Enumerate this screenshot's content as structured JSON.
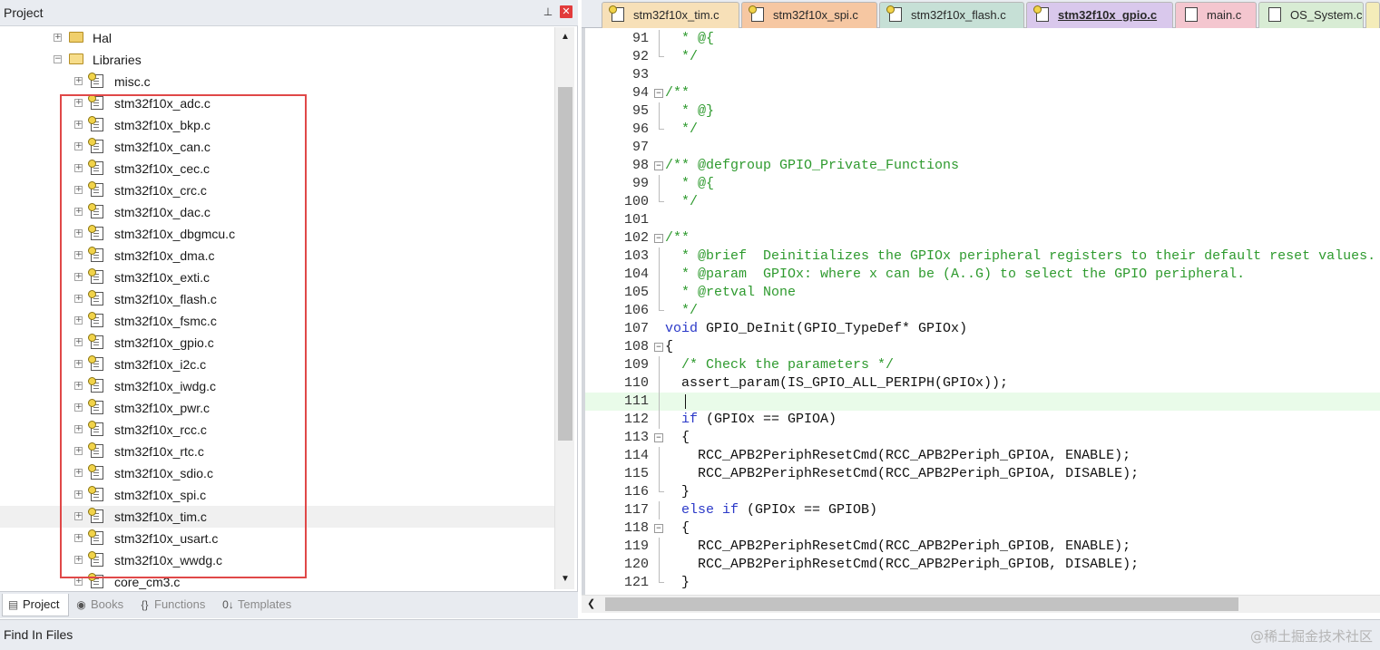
{
  "project_panel": {
    "title": "Project",
    "pin_glyph": "⊥",
    "close_glyph": "✕",
    "tree": [
      {
        "label": "Hal",
        "kind": "folder",
        "expander": "+",
        "hl": false
      },
      {
        "label": "Libraries",
        "kind": "folder-open",
        "expander": "−",
        "hl": false
      },
      {
        "label": "misc.c",
        "kind": "file",
        "expander": "+",
        "hl": false
      },
      {
        "label": "stm32f10x_adc.c",
        "kind": "file",
        "expander": "+",
        "hl": false
      },
      {
        "label": "stm32f10x_bkp.c",
        "kind": "file",
        "expander": "+",
        "hl": false
      },
      {
        "label": "stm32f10x_can.c",
        "kind": "file",
        "expander": "+",
        "hl": false
      },
      {
        "label": "stm32f10x_cec.c",
        "kind": "file",
        "expander": "+",
        "hl": false
      },
      {
        "label": "stm32f10x_crc.c",
        "kind": "file",
        "expander": "+",
        "hl": false
      },
      {
        "label": "stm32f10x_dac.c",
        "kind": "file",
        "expander": "+",
        "hl": false
      },
      {
        "label": "stm32f10x_dbgmcu.c",
        "kind": "file",
        "expander": "+",
        "hl": false
      },
      {
        "label": "stm32f10x_dma.c",
        "kind": "file",
        "expander": "+",
        "hl": false
      },
      {
        "label": "stm32f10x_exti.c",
        "kind": "file",
        "expander": "+",
        "hl": false
      },
      {
        "label": "stm32f10x_flash.c",
        "kind": "file",
        "expander": "+",
        "hl": false
      },
      {
        "label": "stm32f10x_fsmc.c",
        "kind": "file",
        "expander": "+",
        "hl": false
      },
      {
        "label": "stm32f10x_gpio.c",
        "kind": "file",
        "expander": "+",
        "hl": false
      },
      {
        "label": "stm32f10x_i2c.c",
        "kind": "file",
        "expander": "+",
        "hl": false
      },
      {
        "label": "stm32f10x_iwdg.c",
        "kind": "file",
        "expander": "+",
        "hl": false
      },
      {
        "label": "stm32f10x_pwr.c",
        "kind": "file",
        "expander": "+",
        "hl": false
      },
      {
        "label": "stm32f10x_rcc.c",
        "kind": "file",
        "expander": "+",
        "hl": false
      },
      {
        "label": "stm32f10x_rtc.c",
        "kind": "file",
        "expander": "+",
        "hl": false
      },
      {
        "label": "stm32f10x_sdio.c",
        "kind": "file",
        "expander": "+",
        "hl": false
      },
      {
        "label": "stm32f10x_spi.c",
        "kind": "file",
        "expander": "+",
        "hl": false
      },
      {
        "label": "stm32f10x_tim.c",
        "kind": "file",
        "expander": "+",
        "hl": true
      },
      {
        "label": "stm32f10x_usart.c",
        "kind": "file",
        "expander": "+",
        "hl": false
      },
      {
        "label": "stm32f10x_wwdg.c",
        "kind": "file",
        "expander": "+",
        "hl": false
      },
      {
        "label": "core_cm3.c",
        "kind": "file",
        "expander": "+",
        "hl": false
      }
    ],
    "highlight_color": "#e04848",
    "scroll_up": "▲",
    "scroll_down": "▼"
  },
  "bottom_tabs": [
    {
      "label": "Project",
      "icon": "project-window-icon",
      "glyph": "▤",
      "active": true
    },
    {
      "label": "Books",
      "icon": "books-icon",
      "glyph": "◉",
      "active": false
    },
    {
      "label": "Functions",
      "icon": "functions-icon",
      "glyph": "{}",
      "active": false
    },
    {
      "label": "Templates",
      "icon": "templates-icon",
      "glyph": "0↓",
      "active": false
    }
  ],
  "editor_tabs": [
    {
      "label": "stm32f10x_tim.c",
      "color": "#f7e0b8",
      "active": false,
      "icon": "c-file-key-icon"
    },
    {
      "label": "stm32f10x_spi.c",
      "color": "#f6c7a2",
      "active": false,
      "icon": "c-file-key-icon"
    },
    {
      "label": "stm32f10x_flash.c",
      "color": "#c6e0d6",
      "active": false,
      "icon": "c-file-key-icon"
    },
    {
      "label": "stm32f10x_gpio.c",
      "color": "#d9c8ec",
      "active": true,
      "icon": "c-file-key-icon"
    },
    {
      "label": "main.c",
      "color": "#f4c6cf",
      "active": false,
      "icon": "c-file-icon"
    },
    {
      "label": "OS_System.c",
      "color": "#d8ecd4",
      "active": false,
      "icon": "c-file-icon"
    },
    {
      "label": "",
      "color": "#f4ecb9",
      "active": false,
      "icon": "c-file-icon"
    }
  ],
  "code_lines": [
    {
      "n": "91",
      "fold": "",
      "text": "  * @{",
      "cls": "cm"
    },
    {
      "n": "92",
      "fold": "",
      "text": "  */",
      "cls": "cm"
    },
    {
      "n": "93",
      "fold": "",
      "text": "",
      "cls": ""
    },
    {
      "n": "94",
      "fold": "−",
      "text": "/**",
      "cls": "cm"
    },
    {
      "n": "95",
      "fold": "",
      "text": "  * @}",
      "cls": "cm"
    },
    {
      "n": "96",
      "fold": "",
      "text": "  */",
      "cls": "cm"
    },
    {
      "n": "97",
      "fold": "",
      "text": "",
      "cls": ""
    },
    {
      "n": "98",
      "fold": "−",
      "text": "/** @defgroup GPIO_Private_Functions",
      "cls": "cm"
    },
    {
      "n": "99",
      "fold": "",
      "text": "  * @{",
      "cls": "cm"
    },
    {
      "n": "100",
      "fold": "",
      "text": "  */",
      "cls": "cm"
    },
    {
      "n": "101",
      "fold": "",
      "text": "",
      "cls": ""
    },
    {
      "n": "102",
      "fold": "−",
      "text": "/**",
      "cls": "cm"
    },
    {
      "n": "103",
      "fold": "",
      "text": "  * @brief  Deinitializes the GPIOx peripheral registers to their default reset values.",
      "cls": "cm"
    },
    {
      "n": "104",
      "fold": "",
      "text": "  * @param  GPIOx: where x can be (A..G) to select the GPIO peripheral.",
      "cls": "cm"
    },
    {
      "n": "105",
      "fold": "",
      "text": "  * @retval None",
      "cls": "cm"
    },
    {
      "n": "106",
      "fold": "",
      "text": "  */",
      "cls": "cm"
    },
    {
      "n": "107",
      "fold": "",
      "text": "void GPIO_DeInit(GPIO_TypeDef* GPIOx)",
      "cls": "fn"
    },
    {
      "n": "108",
      "fold": "−",
      "text": "{",
      "cls": ""
    },
    {
      "n": "109",
      "fold": "",
      "text": "  /* Check the parameters */",
      "cls": "cm"
    },
    {
      "n": "110",
      "fold": "",
      "text": "  assert_param(IS_GPIO_ALL_PERIPH(GPIOx));",
      "cls": ""
    },
    {
      "n": "111",
      "fold": "",
      "text": "",
      "cls": "cur"
    },
    {
      "n": "112",
      "fold": "",
      "text": "  if (GPIOx == GPIOA)",
      "cls": "if"
    },
    {
      "n": "113",
      "fold": "−",
      "text": "  {",
      "cls": ""
    },
    {
      "n": "114",
      "fold": "",
      "text": "    RCC_APB2PeriphResetCmd(RCC_APB2Periph_GPIOA, ENABLE);",
      "cls": ""
    },
    {
      "n": "115",
      "fold": "",
      "text": "    RCC_APB2PeriphResetCmd(RCC_APB2Periph_GPIOA, DISABLE);",
      "cls": ""
    },
    {
      "n": "116",
      "fold": "",
      "text": "  }",
      "cls": ""
    },
    {
      "n": "117",
      "fold": "",
      "text": "  else if (GPIOx == GPIOB)",
      "cls": "elif"
    },
    {
      "n": "118",
      "fold": "−",
      "text": "  {",
      "cls": ""
    },
    {
      "n": "119",
      "fold": "",
      "text": "    RCC_APB2PeriphResetCmd(RCC_APB2Periph_GPIOB, ENABLE);",
      "cls": ""
    },
    {
      "n": "120",
      "fold": "",
      "text": "    RCC_APB2PeriphResetCmd(RCC_APB2Periph_GPIOB, DISABLE);",
      "cls": ""
    },
    {
      "n": "121",
      "fold": "",
      "text": "  }",
      "cls": ""
    }
  ],
  "hscroll_left": "❮",
  "bottom_bar": {
    "label": "Find In Files",
    "watermark": "@稀土掘金技术社区"
  }
}
